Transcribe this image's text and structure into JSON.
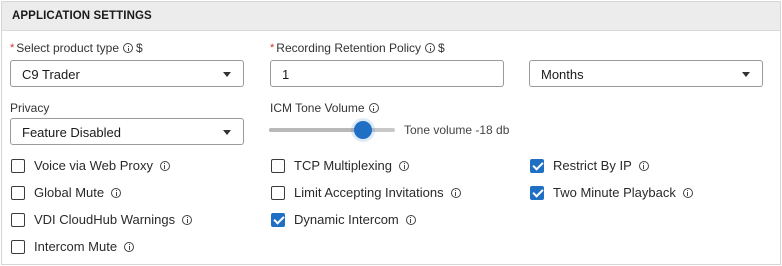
{
  "header": {
    "title": "APPLICATION SETTINGS"
  },
  "product_type": {
    "label": "Select product type",
    "required": "*",
    "currency": "$",
    "value": "C9 Trader"
  },
  "retention": {
    "label": "Recording Retention Policy",
    "required": "*",
    "currency": "$",
    "value": "1",
    "unit": "Months"
  },
  "privacy": {
    "label": "Privacy",
    "value": "Feature Disabled"
  },
  "icm_tone": {
    "label": "ICM Tone Volume",
    "display": "Tone volume -18 db",
    "level_percent": 68
  },
  "checkboxes": {
    "voice_web_proxy": {
      "label": "Voice via Web Proxy",
      "checked": false
    },
    "global_mute": {
      "label": "Global Mute",
      "checked": false
    },
    "vdi_cloudhub": {
      "label": "VDI CloudHub Warnings",
      "checked": false
    },
    "intercom_mute": {
      "label": "Intercom Mute",
      "checked": false
    },
    "tcp_multiplexing": {
      "label": "TCP Multiplexing",
      "checked": false
    },
    "limit_invitations": {
      "label": "Limit Accepting Invitations",
      "checked": false
    },
    "dynamic_intercom": {
      "label": "Dynamic Intercom",
      "checked": true
    },
    "restrict_by_ip": {
      "label": "Restrict By IP",
      "checked": true
    },
    "two_minute_playback": {
      "label": "Two Minute Playback",
      "checked": true
    }
  },
  "colors": {
    "accent": "#1f6fc5",
    "required": "#d32f2f",
    "header_bg": "#ececec"
  },
  "icons": [
    "info-icon",
    "chevron-down-icon",
    "checkmark-icon"
  ]
}
